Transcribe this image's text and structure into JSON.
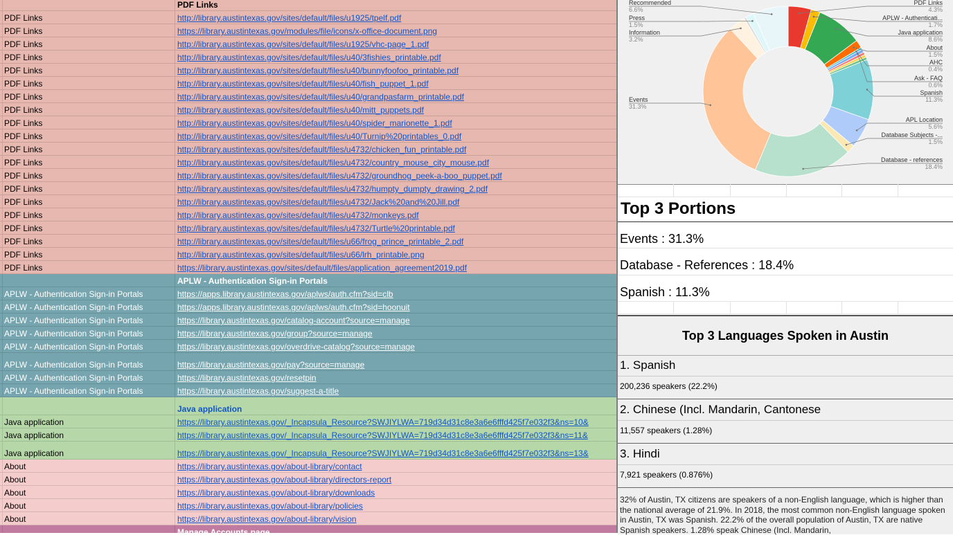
{
  "sheet": {
    "pdf_header": "PDF Links",
    "pdf_rows": [
      {
        "category": "PDF Links",
        "url": "http://library.austintexas.gov/sites/default/files/u1925/tpelf.pdf"
      },
      {
        "category": "PDF Links",
        "url": "https://library.austintexas.gov/modules/file/icons/x-office-document.png"
      },
      {
        "category": "PDF Links",
        "url": "http://library.austintexas.gov/sites/default/files/u1925/vhc-page_1.pdf"
      },
      {
        "category": "PDF Links",
        "url": "http://library.austintexas.gov/sites/default/files/u40/3fishies_printable.pdf"
      },
      {
        "category": "PDF Links",
        "url": "http://library.austintexas.gov/sites/default/files/u40/bunnyfoofoo_printable.pdf"
      },
      {
        "category": "PDF Links",
        "url": "http://library.austintexas.gov/sites/default/files/u40/fish_puppet_1.pdf"
      },
      {
        "category": "PDF Links",
        "url": "http://library.austintexas.gov/sites/default/files/u40/grandpasfarm_printable.pdf"
      },
      {
        "category": "PDF Links",
        "url": "http://library.austintexas.gov/sites/default/files/u40/mitt_puppets.pdf"
      },
      {
        "category": "PDF Links",
        "url": "http://library.austintexas.gov/sites/default/files/u40/spider_marionette_1.pdf"
      },
      {
        "category": "PDF Links",
        "url": "http://library.austintexas.gov/sites/default/files/u40/Turnip%20printables_0.pdf"
      },
      {
        "category": "PDF Links",
        "url": "http://library.austintexas.gov/sites/default/files/u4732/chicken_fun_printable.pdf"
      },
      {
        "category": "PDF Links",
        "url": "http://library.austintexas.gov/sites/default/files/u4732/country_mouse_city_mouse.pdf"
      },
      {
        "category": "PDF Links",
        "url": "http://library.austintexas.gov/sites/default/files/u4732/groundhog_peek-a-boo_puppet.pdf"
      },
      {
        "category": "PDF Links",
        "url": "http://library.austintexas.gov/sites/default/files/u4732/humpty_dumpty_drawing_2.pdf"
      },
      {
        "category": "PDF Links",
        "url": "http://library.austintexas.gov/sites/default/files/u4732/Jack%20and%20Jill.pdf"
      },
      {
        "category": "PDF Links",
        "url": "http://library.austintexas.gov/sites/default/files/u4732/monkeys.pdf"
      },
      {
        "category": "PDF Links",
        "url": "http://library.austintexas.gov/sites/default/files/u4732/Turtle%20printable.pdf"
      },
      {
        "category": "PDF Links",
        "url": "http://library.austintexas.gov/sites/default/files/u66/frog_prince_printable_2.pdf"
      },
      {
        "category": "PDF Links",
        "url": "http://library.austintexas.gov/sites/default/files/u66/lrh_printable.png"
      },
      {
        "category": "PDF Links",
        "url": "https://library.austintexas.gov/sites/default/files/application_agreement2019.pdf"
      }
    ],
    "aplw_header": "APLW - Authentication Sign-in Portals",
    "aplw_rows": [
      {
        "category": "APLW - Authentication Sign-in Portals",
        "url": "https://apps.library.austintexas.gov/aplws/auth.cfm?sid=clb"
      },
      {
        "category": "APLW - Authentication Sign-in Portals",
        "url": "https://apps.library.austintexas.gov/aplws/auth.cfm?sid=hoonuit"
      },
      {
        "category": "APLW - Authentication Sign-in Portals",
        "url": "https://library.austintexas.gov/catalog-account?source=manage"
      },
      {
        "category": "APLW - Authentication Sign-in Portals",
        "url": "https://library.austintexas.gov/group?source=manage"
      },
      {
        "category": "APLW - Authentication Sign-in Portals",
        "url": "https://library.austintexas.gov/overdrive-catalog?source=manage"
      },
      {
        "category": "APLW - Authentication Sign-in Portals",
        "url": "https://library.austintexas.gov/pay?source=manage"
      },
      {
        "category": "APLW - Authentication Sign-in Portals",
        "url": "https://library.austintexas.gov/resetpin"
      },
      {
        "category": "APLW - Authentication Sign-in Portals",
        "url": "https://library.austintexas.gov/suggest-a-title"
      }
    ],
    "java_header": "Java application",
    "java_rows": [
      {
        "category": "Java application",
        "url": "https://library.austintexas.gov/_Incapsula_Resource?SWJIYLWA=719d34d31c8e3a6e6fffd425f7e032f3&ns=10&"
      },
      {
        "category": "Java application",
        "url": "https://library.austintexas.gov/_Incapsula_Resource?SWJIYLWA=719d34d31c8e3a6e6fffd425f7e032f3&ns=11&"
      },
      {
        "category": "Java application",
        "url": "https://library.austintexas.gov/_Incapsula_Resource?SWJIYLWA=719d34d31c8e3a6e6fffd425f7e032f3&ns=13&"
      }
    ],
    "about_rows": [
      {
        "category": "About",
        "url": "https://library.austintexas.gov/about-library/contact"
      },
      {
        "category": "About",
        "url": "https://library.austintexas.gov/about-library/directors-report"
      },
      {
        "category": "About",
        "url": "https://library.austintexas.gov/about-library/downloads"
      },
      {
        "category": "About",
        "url": "https://library.austintexas.gov/about-library/policies"
      },
      {
        "category": "About",
        "url": "https://library.austintexas.gov/about-library/vision"
      }
    ],
    "manage_header": "Manage Accounts page"
  },
  "chart_data": {
    "type": "pie",
    "style": "donut",
    "slices": [
      {
        "label": "PDF Links",
        "value": 4.3,
        "color": "#e8392f"
      },
      {
        "label": "APLW - Authenticati...",
        "value": 1.7,
        "color": "#fbbc04"
      },
      {
        "label": "Java application",
        "value": 8.6,
        "color": "#34a853"
      },
      {
        "label": "About",
        "value": 1.5,
        "color": "#ff6d01"
      },
      {
        "label": "AHC",
        "value": 0.4,
        "color": "#46bdc6"
      },
      {
        "label": "Ask - FAQ",
        "value": 0.6,
        "color": "#7baaf7"
      },
      {
        "label": "",
        "value": 0.5,
        "color": "#f07b72"
      },
      {
        "label": "",
        "value": 0.5,
        "color": "#fcd04f"
      },
      {
        "label": "",
        "value": 0.5,
        "color": "#71c287"
      },
      {
        "label": "Spanish",
        "value": 11.3,
        "color": "#7ed1d7"
      },
      {
        "label": "APL Location",
        "value": 5.6,
        "color": "#afcbfa"
      },
      {
        "label": "Database Subjects -...",
        "value": 1.5,
        "color": "#fce8b2"
      },
      {
        "label": "Database - references",
        "value": 18.4,
        "color": "#b7e1cd"
      },
      {
        "label": "Events",
        "value": 31.3,
        "color": "#ffc599"
      },
      {
        "label": "Information",
        "value": 3.2,
        "color": "#fff2e0"
      },
      {
        "label": "",
        "value": 0.4,
        "color": "#d9d9d9"
      },
      {
        "label": "Press",
        "value": 1.5,
        "color": "#e0f7fa"
      },
      {
        "label": "Recommended",
        "value": 6.6,
        "color": "#e8f6fa"
      }
    ],
    "right_labels": [
      {
        "label": "PDF Links",
        "pct": "4.3%"
      },
      {
        "label": "APLW - Authenticati...",
        "pct": "1.7%"
      },
      {
        "label": "Java application",
        "pct": "8.6%"
      },
      {
        "label": "About",
        "pct": "1.5%"
      },
      {
        "label": "AHC",
        "pct": "0.4%"
      },
      {
        "label": "Ask - FAQ",
        "pct": "0.6%"
      },
      {
        "label": "Spanish",
        "pct": "11.3%"
      },
      {
        "label": "APL Location",
        "pct": "5.6%"
      },
      {
        "label": "Database Subjects -...",
        "pct": "1.5%"
      },
      {
        "label": "Database - references",
        "pct": "18.4%"
      }
    ],
    "left_labels": [
      {
        "label": "Recommended",
        "pct": "6.6%"
      },
      {
        "label": "Press",
        "pct": "1.5%"
      },
      {
        "label": "Information",
        "pct": "3.2%"
      },
      {
        "label": "Events",
        "pct": "31.3%"
      }
    ]
  },
  "portions": {
    "title": "Top 3 Portions",
    "items": [
      "Events : 31.3%",
      "Database - References : 18.4%",
      "Spanish : 11.3%"
    ]
  },
  "languages": {
    "title": "Top 3 Languages Spoken in Austin",
    "items": [
      {
        "name": "1. Spanish",
        "count": "200,236 speakers (22.2%)"
      },
      {
        "name": "2. Chinese (Incl. Mandarin, Cantonese",
        "count": "11,557 speakers (1.28%)"
      },
      {
        "name": "3. Hindi",
        "count": "7,921 speakers (0.876%)"
      }
    ],
    "paragraph": "32% of Austin, TX citizens are speakers of a non-English language, which is higher than the national average of 21.9%. In 2018, the most common non-English language spoken in Austin, TX was Spanish. 22.2% of the overall population of Austin, TX are native Spanish speakers. 1.28% speak Chinese (Incl. Mandarin,"
  }
}
